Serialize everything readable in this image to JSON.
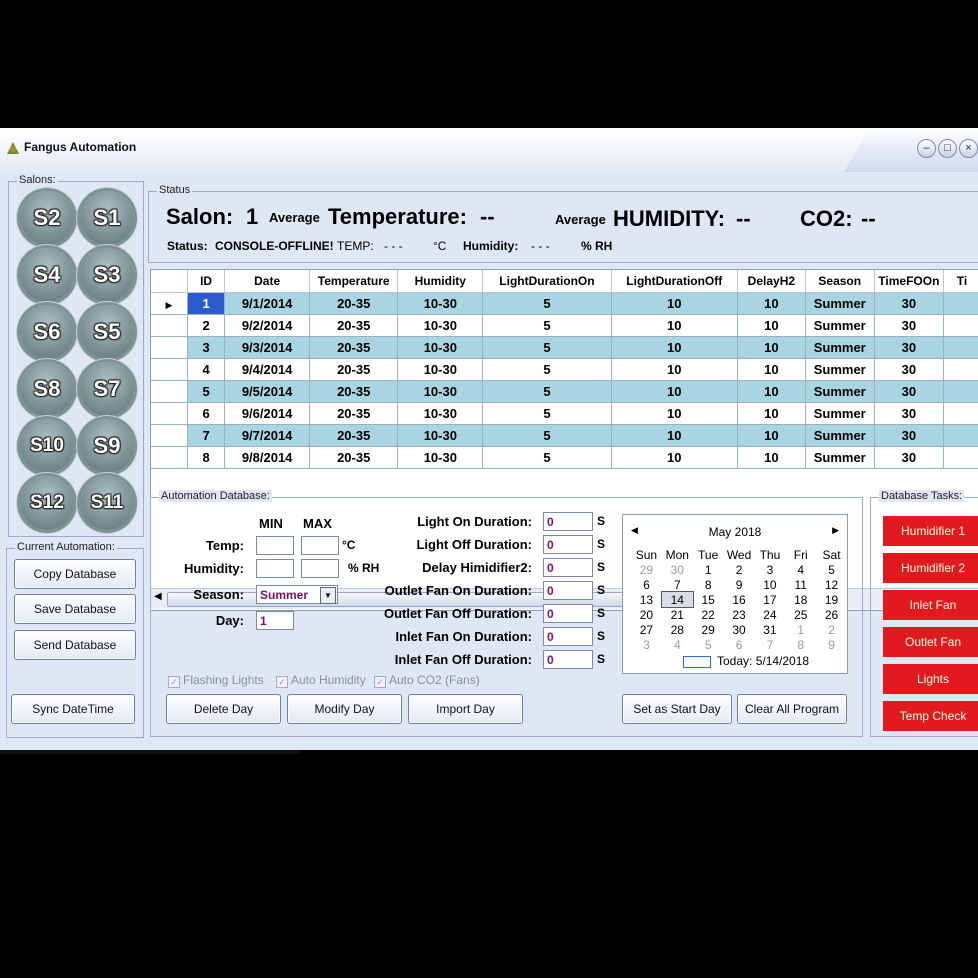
{
  "window": {
    "title": "Fangus Automation"
  },
  "salons": {
    "label": "Salons:",
    "buttons": [
      "S2",
      "S1",
      "S4",
      "S3",
      "S6",
      "S5",
      "S8",
      "S7",
      "S10",
      "S9",
      "S12",
      "S11"
    ]
  },
  "current_automation": {
    "label": "Current Automation:",
    "copy": "Copy Database",
    "save": "Save Database",
    "send": "Send Database",
    "sync": "Sync DateTime"
  },
  "status": {
    "label": "Status",
    "salon_label": "Salon:",
    "salon_value": "1",
    "average1": "Average",
    "temperature_label": "Temperature:",
    "temperature_value": "--",
    "average2": "Average",
    "humidity_label": "HUMIDITY:",
    "humidity_value": "--",
    "co2_label": "CO2:",
    "co2_value": "--",
    "status_label": "Status:",
    "status_value": "CONSOLE-OFFLINE!",
    "temp_label": "TEMP:",
    "temp_value": "- - -",
    "temp_unit": "°C",
    "hum_label": "Humidity:",
    "hum_value": "- - -",
    "hum_unit": "% RH"
  },
  "grid": {
    "columns": [
      "ID",
      "Date",
      "Temperature",
      "Humidity",
      "LightDurationOn",
      "LightDurationOff",
      "DelayH2",
      "Season",
      "TimeFOOn",
      "Ti"
    ],
    "rows": [
      [
        "1",
        "9/1/2014",
        "20-35",
        "10-30",
        "5",
        "10",
        "10",
        "Summer",
        "30",
        ""
      ],
      [
        "2",
        "9/2/2014",
        "20-35",
        "10-30",
        "5",
        "10",
        "10",
        "Summer",
        "30",
        ""
      ],
      [
        "3",
        "9/3/2014",
        "20-35",
        "10-30",
        "5",
        "10",
        "10",
        "Summer",
        "30",
        ""
      ],
      [
        "4",
        "9/4/2014",
        "20-35",
        "10-30",
        "5",
        "10",
        "10",
        "Summer",
        "30",
        ""
      ],
      [
        "5",
        "9/5/2014",
        "20-35",
        "10-30",
        "5",
        "10",
        "10",
        "Summer",
        "30",
        ""
      ],
      [
        "6",
        "9/6/2014",
        "20-35",
        "10-30",
        "5",
        "10",
        "10",
        "Summer",
        "30",
        ""
      ],
      [
        "7",
        "9/7/2014",
        "20-35",
        "10-30",
        "5",
        "10",
        "10",
        "Summer",
        "30",
        ""
      ],
      [
        "8",
        "9/8/2014",
        "20-35",
        "10-30",
        "5",
        "10",
        "10",
        "Summer",
        "30",
        ""
      ]
    ]
  },
  "automation_db": {
    "label": "Automation Database:",
    "min": "MIN",
    "max": "MAX",
    "temp": "Temp:",
    "temp_unit": "°C",
    "humidity": "Humidity:",
    "humidity_unit": "% RH",
    "season": "Season:",
    "season_value": "Summer",
    "day": "Day:",
    "day_value": "1",
    "light_on": "Light On Duration:",
    "light_off": "Light Off Duration:",
    "delay_h2": "Delay Himidifier2:",
    "outlet_on": "Outlet Fan On Duration:",
    "outlet_off": "Outlet Fan Off Duration:",
    "inlet_on": "Inlet Fan On Duration:",
    "inlet_off": "Inlet Fan Off Duration:",
    "duration_values": [
      "0",
      "0",
      "0",
      "0",
      "0",
      "0",
      "0"
    ],
    "seconds_unit": "S",
    "flashing": "Flashing Lights",
    "auto_humidity": "Auto Humidity",
    "auto_co2": "Auto CO2 (Fans)",
    "delete_day": "Delete Day",
    "modify_day": "Modify Day",
    "import_day": "Import Day",
    "set_start": "Set as Start Day",
    "clear_all": "Clear All Program"
  },
  "calendar": {
    "month": "May 2018",
    "weekdays": [
      "Sun",
      "Mon",
      "Tue",
      "Wed",
      "Thu",
      "Fri",
      "Sat"
    ],
    "weeks": [
      [
        "29",
        "30",
        "1",
        "2",
        "3",
        "4",
        "5"
      ],
      [
        "6",
        "7",
        "8",
        "9",
        "10",
        "11",
        "12"
      ],
      [
        "13",
        "14",
        "15",
        "16",
        "17",
        "18",
        "19"
      ],
      [
        "20",
        "21",
        "22",
        "23",
        "24",
        "25",
        "26"
      ],
      [
        "27",
        "28",
        "29",
        "30",
        "31",
        "1",
        "2"
      ],
      [
        "3",
        "4",
        "5",
        "6",
        "7",
        "8",
        "9"
      ]
    ],
    "today": "Today: 5/14/2018"
  },
  "db_tasks": {
    "label": "Database Tasks:",
    "items": [
      "Humidifier 1",
      "Humidifier 2",
      "Inlet Fan",
      "Outlet Fan",
      "Lights",
      "Temp Check"
    ],
    "color": "#e01a1f"
  }
}
